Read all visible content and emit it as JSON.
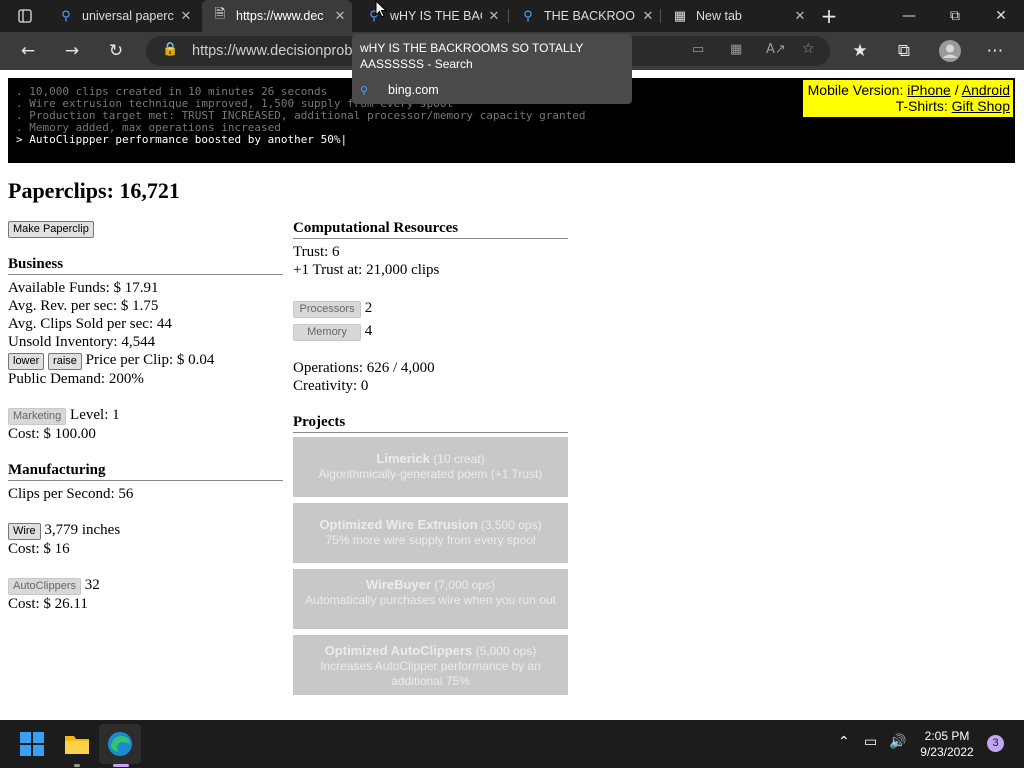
{
  "browser": {
    "tabs": [
      {
        "icon": "search-icon",
        "title": "universal papercl"
      },
      {
        "icon": "page-icon",
        "title": "https://www.dec"
      },
      {
        "icon": "search-icon",
        "title": "wHY IS THE BAC"
      },
      {
        "icon": "search-icon",
        "title": "THE BACKROOM"
      },
      {
        "icon": "newtab-icon",
        "title": "New tab"
      }
    ],
    "address": "https://www.decisionprob",
    "suggestion": {
      "title": "wHY IS THE BACKROOMS SO TOTALLY AASSSSSS - Search",
      "source": "bing.com"
    }
  },
  "console": {
    "lines": [
      ". 10,000 clips created in 10 minutes 26 seconds",
      ". Wire extrusion technique improved, 1,500 supply from every spool",
      ". Production target met: TRUST INCREASED, additional processor/memory capacity granted",
      ". Memory added, max operations increased",
      "> AutoClippper performance boosted by another 50%|"
    ]
  },
  "promo": {
    "mobile_prefix": "Mobile Version:",
    "iphone": "iPhone",
    "sep": "/",
    "android": "Android",
    "tshirt_prefix": "T-Shirts:",
    "gift": "Gift Shop"
  },
  "clips": {
    "label": "Paperclips: 16,721",
    "make_button": "Make Paperclip"
  },
  "business": {
    "heading": "Business",
    "funds": "Available Funds: $ 17.91",
    "rev": "Avg. Rev. per sec: $ 1.75",
    "sold": "Avg. Clips Sold per sec: 44",
    "inventory": "Unsold Inventory: 4,544",
    "lower": "lower",
    "raise": "raise",
    "price": "Price per Clip: $ 0.04",
    "demand": "Public Demand: 200%",
    "marketing_button": "Marketing",
    "marketing_level": "Level: 1",
    "marketing_cost": "Cost: $ 100.00"
  },
  "manufacturing": {
    "heading": "Manufacturing",
    "cps": "Clips per Second: 56",
    "wire_button": "Wire",
    "wire_amount": "3,779 inches",
    "wire_cost": "Cost: $ 16",
    "autoclipper_button": "AutoClippers",
    "autoclipper_count": "32",
    "autoclipper_cost": "Cost: $ 26.11"
  },
  "computational": {
    "heading": "Computational Resources",
    "trust": "Trust: 6",
    "next_trust": "+1 Trust at: 21,000 clips",
    "processors_button": "Processors",
    "processors": "2",
    "memory_button": "Memory",
    "memory": "4",
    "operations": "Operations: 626 / 4,000",
    "creativity": "Creativity: 0"
  },
  "projects": {
    "heading": "Projects",
    "items": [
      {
        "name": "Limerick",
        "cost": "(10 creat)",
        "desc": "Algorithmically-generated poem (+1 Trust)"
      },
      {
        "name": "Optimized Wire Extrusion",
        "cost": "(3,500 ops)",
        "desc": "75% more wire supply from every spool"
      },
      {
        "name": "WireBuyer",
        "cost": "(7,000 ops)",
        "desc": "Automatically purchases wire when you run out"
      },
      {
        "name": "Optimized AutoClippers",
        "cost": "(5,000 ops)",
        "desc": "Increases AutoClipper performance by an additional 75%"
      }
    ]
  },
  "taskbar": {
    "time": "2:05 PM",
    "date": "9/23/2022",
    "notifications": "3"
  }
}
